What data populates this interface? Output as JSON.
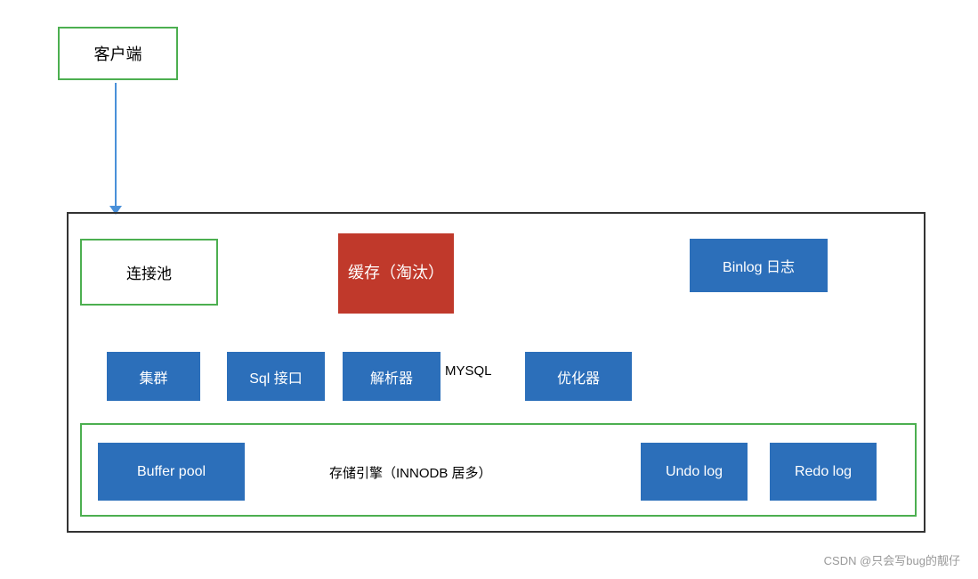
{
  "client": {
    "label": "客户端"
  },
  "main": {
    "conn_pool": "连接池",
    "cache_box_line1": "缓存（淘",
    "cache_box_line2": "汰）",
    "binlog": "Binlog 日志",
    "cluster": "集群",
    "sql": "Sql 接口",
    "parser": "解析器",
    "mysql_label": "MYSQL",
    "optimizer": "优化器",
    "storage_label": "存储引擎（INNODB 居多）",
    "buffer_pool": "Buffer pool",
    "undo_log": "Undo log",
    "redo_log": "Redo log"
  },
  "watermark": "CSDN @只会写bug的靓仔"
}
